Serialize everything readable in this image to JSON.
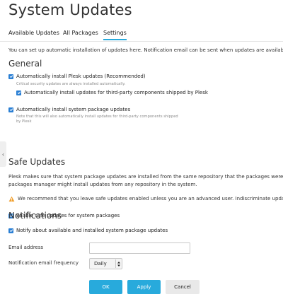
{
  "page_title": "System Updates",
  "tabs": [
    {
      "label": "Available Updates"
    },
    {
      "label": "All Packages"
    },
    {
      "label": "Settings"
    }
  ],
  "intro_text": "You can set up automatic installation of updates here. Notification email can be sent when updates are available",
  "general": {
    "heading": "General",
    "auto_plesk_label": "Automatically install Plesk updates (Recommended)",
    "auto_plesk_hint": "Critical security updates are always installed automatically.",
    "third_party_label": "Automatically install updates for third-party components shipped by Plesk",
    "system_packages_label": "Automatically install system package updates",
    "system_packages_hint_line1": "Note that this will also automatically install updates for third-party components shipped",
    "system_packages_hint_line2": "by Plesk"
  },
  "safe_updates": {
    "heading": "Safe Updates",
    "description_line1": "Plesk makes sure that system package updates are installed from the same repository that the packages were ini",
    "description_line2": "packages manager might install updates from any repository in the system.",
    "warning": "We recommend that you leave safe updates enabled unless you are an advanced user. Indiscriminate updates",
    "enable_label": "Enable safe updates for system packages"
  },
  "notifications": {
    "heading": "Notifications",
    "notify_label": "Notify about available and installed system package updates",
    "email_label": "Email address",
    "email_value": "",
    "frequency_label": "Notification email frequency",
    "frequency_value": "Daily"
  },
  "buttons": {
    "ok": "OK",
    "apply": "Apply",
    "cancel": "Cancel"
  },
  "side_tab_glyph": "‹",
  "colors": {
    "accent": "#28aadc",
    "checkbox": "#2a7fd4",
    "warning": "#f0a030"
  }
}
